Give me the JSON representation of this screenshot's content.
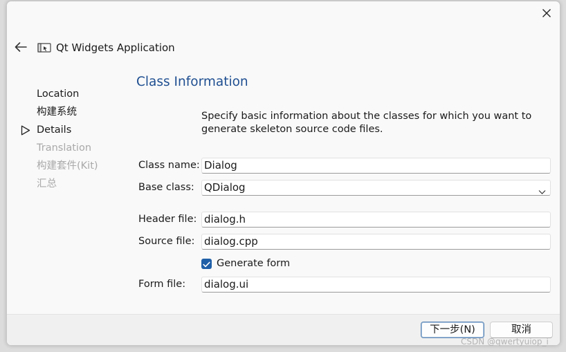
{
  "window": {
    "app_title": "Qt Widgets Application"
  },
  "steps": [
    {
      "label": "Location",
      "state": "done"
    },
    {
      "label": "构建系统",
      "state": "done"
    },
    {
      "label": "Details",
      "state": "current"
    },
    {
      "label": "Translation",
      "state": "pending"
    },
    {
      "label": "构建套件(Kit)",
      "state": "pending"
    },
    {
      "label": "汇总",
      "state": "pending"
    }
  ],
  "page": {
    "title": "Class Information",
    "description": "Specify basic information about the classes for which you want to generate skeleton source code files."
  },
  "form": {
    "class_name_label": "Class name:",
    "class_name_value": "Dialog",
    "base_class_label": "Base class:",
    "base_class_value": "QDialog",
    "header_file_label": "Header file:",
    "header_file_value": "dialog.h",
    "source_file_label": "Source file:",
    "source_file_value": "dialog.cpp",
    "generate_form_label": "Generate form",
    "generate_form_checked": true,
    "form_file_label": "Form file:",
    "form_file_value": "dialog.ui"
  },
  "buttons": {
    "next": "下一步(N)",
    "cancel": "取消"
  },
  "watermark": "CSDN @qwertyuiop_i",
  "colors": {
    "title_blue": "#1f4f91",
    "checkbox_blue": "#1f5fa8",
    "disabled_text": "#a9a9a9"
  },
  "icons": {
    "close": "close-icon",
    "back": "back-arrow-icon",
    "app": "qt-widgets-app-icon",
    "current_step": "triangle-right-icon",
    "combo": "chevron-down-icon",
    "check": "checkmark-icon"
  }
}
